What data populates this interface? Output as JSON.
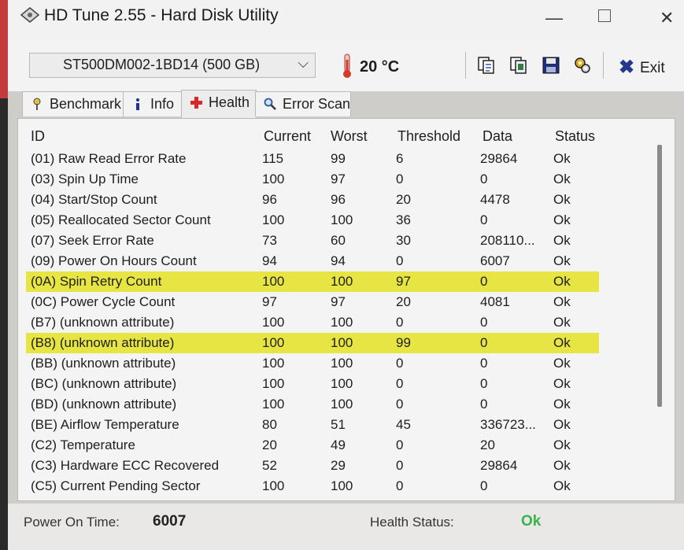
{
  "window": {
    "title": "HD Tune 2.55 - Hard Disk Utility"
  },
  "toolbar": {
    "drive": "ST500DM002-1BD14 (500 GB)",
    "temperature": "20 °C",
    "exit_label": "Exit",
    "icons": [
      "copy-text-icon",
      "copy-screenshot-icon",
      "save-icon",
      "options-icon"
    ]
  },
  "tabs": [
    {
      "label": "Benchmark",
      "icon": "benchmark-icon"
    },
    {
      "label": "Info",
      "icon": "info-icon"
    },
    {
      "label": "Health",
      "icon": "health-icon",
      "active": true
    },
    {
      "label": "Error Scan",
      "icon": "magnifier-icon"
    }
  ],
  "table": {
    "headers": [
      "ID",
      "Current",
      "Worst",
      "Threshold",
      "Data",
      "Status"
    ],
    "rows": [
      {
        "id": "(01) Raw Read Error Rate",
        "current": "115",
        "worst": "99",
        "threshold": "6",
        "data": "29864",
        "status": "Ok",
        "highlight": false
      },
      {
        "id": "(03) Spin Up Time",
        "current": "100",
        "worst": "97",
        "threshold": "0",
        "data": "0",
        "status": "Ok",
        "highlight": false
      },
      {
        "id": "(04) Start/Stop Count",
        "current": "96",
        "worst": "96",
        "threshold": "20",
        "data": "4478",
        "status": "Ok",
        "highlight": false
      },
      {
        "id": "(05) Reallocated Sector Count",
        "current": "100",
        "worst": "100",
        "threshold": "36",
        "data": "0",
        "status": "Ok",
        "highlight": false
      },
      {
        "id": "(07) Seek Error Rate",
        "current": "73",
        "worst": "60",
        "threshold": "30",
        "data": "208110...",
        "status": "Ok",
        "highlight": false
      },
      {
        "id": "(09) Power On Hours Count",
        "current": "94",
        "worst": "94",
        "threshold": "0",
        "data": "6007",
        "status": "Ok",
        "highlight": false
      },
      {
        "id": "(0A) Spin Retry Count",
        "current": "100",
        "worst": "100",
        "threshold": "97",
        "data": "0",
        "status": "Ok",
        "highlight": true
      },
      {
        "id": "(0C) Power Cycle Count",
        "current": "97",
        "worst": "97",
        "threshold": "20",
        "data": "4081",
        "status": "Ok",
        "highlight": false
      },
      {
        "id": "(B7) (unknown attribute)",
        "current": "100",
        "worst": "100",
        "threshold": "0",
        "data": "0",
        "status": "Ok",
        "highlight": false
      },
      {
        "id": "(B8) (unknown attribute)",
        "current": "100",
        "worst": "100",
        "threshold": "99",
        "data": "0",
        "status": "Ok",
        "highlight": true
      },
      {
        "id": "(BB) (unknown attribute)",
        "current": "100",
        "worst": "100",
        "threshold": "0",
        "data": "0",
        "status": "Ok",
        "highlight": false
      },
      {
        "id": "(BC) (unknown attribute)",
        "current": "100",
        "worst": "100",
        "threshold": "0",
        "data": "0",
        "status": "Ok",
        "highlight": false
      },
      {
        "id": "(BD) (unknown attribute)",
        "current": "100",
        "worst": "100",
        "threshold": "0",
        "data": "0",
        "status": "Ok",
        "highlight": false
      },
      {
        "id": "(BE) Airflow Temperature",
        "current": "80",
        "worst": "51",
        "threshold": "45",
        "data": "336723...",
        "status": "Ok",
        "highlight": false
      },
      {
        "id": "(C2) Temperature",
        "current": "20",
        "worst": "49",
        "threshold": "0",
        "data": "20",
        "status": "Ok",
        "highlight": false
      },
      {
        "id": "(C3) Hardware ECC Recovered",
        "current": "52",
        "worst": "29",
        "threshold": "0",
        "data": "29864",
        "status": "Ok",
        "highlight": false
      },
      {
        "id": "(C5) Current Pending Sector",
        "current": "100",
        "worst": "100",
        "threshold": "0",
        "data": "0",
        "status": "Ok",
        "highlight": false
      }
    ]
  },
  "status": {
    "power_on_label": "Power On Time:",
    "power_on_value": "6007",
    "health_label": "Health Status:",
    "health_value": "Ok"
  },
  "colors": {
    "highlight": "#e7e543",
    "ok_green": "#3bb34a",
    "exit_x": "#233a8a",
    "thermometer": "#d43a2a"
  }
}
